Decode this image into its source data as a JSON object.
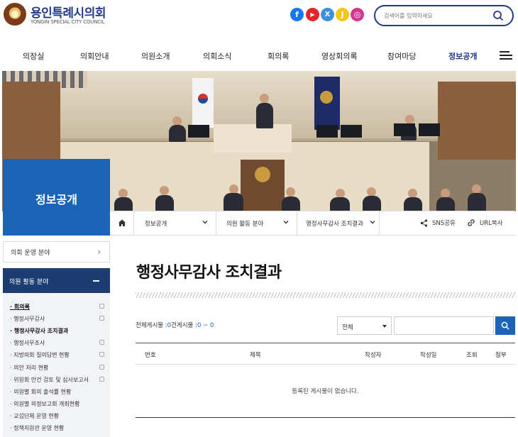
{
  "header": {
    "site_title": "용인특례시의회",
    "site_subtitle": "YONGIN SPECIAL CITY COUNCIL",
    "search_placeholder": "검색어를 입력하세요"
  },
  "social": [
    {
      "name": "facebook",
      "glyph": "f"
    },
    {
      "name": "youtube",
      "glyph": "▶"
    },
    {
      "name": "x",
      "glyph": "X"
    },
    {
      "name": "kakaostory",
      "glyph": "J"
    },
    {
      "name": "instagram",
      "glyph": "◎"
    }
  ],
  "nav": {
    "items": [
      "의장실",
      "의회안내",
      "의원소개",
      "의회소식",
      "회의록",
      "영상회의록",
      "참여마당",
      "정보공개"
    ],
    "active": "정보공개"
  },
  "side": {
    "title": "정보공개",
    "collapsed_item": "의회 운영 분야",
    "active_group": "의원 활동 분야",
    "subitems": [
      "회의록",
      "행정사무감사",
      "행정사무감사 조치결과",
      "행정사무조사",
      "지방의회 질의답변 현황",
      "의안 처리 현황",
      "위원회 안건 검토 및 심사보고서",
      "의원별 회의 출석률 현황",
      "의원별 의정보고회 개최현황",
      "교섭단체 운영 현황",
      "정책지원관 운영 현황"
    ]
  },
  "breadcrumb": {
    "items": [
      "정보공개",
      "의원 활동 분야",
      "행정사무감사 조치결과"
    ],
    "sns_share": "SNS공유",
    "url_copy": "URL복사"
  },
  "content": {
    "title": "행정사무감사 조치결과",
    "count_label": "전체게시물 :",
    "count_value": "0",
    "count_unit": "건",
    "page_label": "게시물 :",
    "page_value": "0 ~ 0",
    "filter_selected": "전체",
    "table_headers": [
      "번호",
      "제목",
      "작성자",
      "작성일",
      "조회",
      "첨부"
    ],
    "empty_message": "등록된 게시물이 없습니다."
  },
  "colors": {
    "brand_blue": "#1b63b7",
    "navy": "#1c3d72",
    "title_blue": "#233a8b"
  }
}
